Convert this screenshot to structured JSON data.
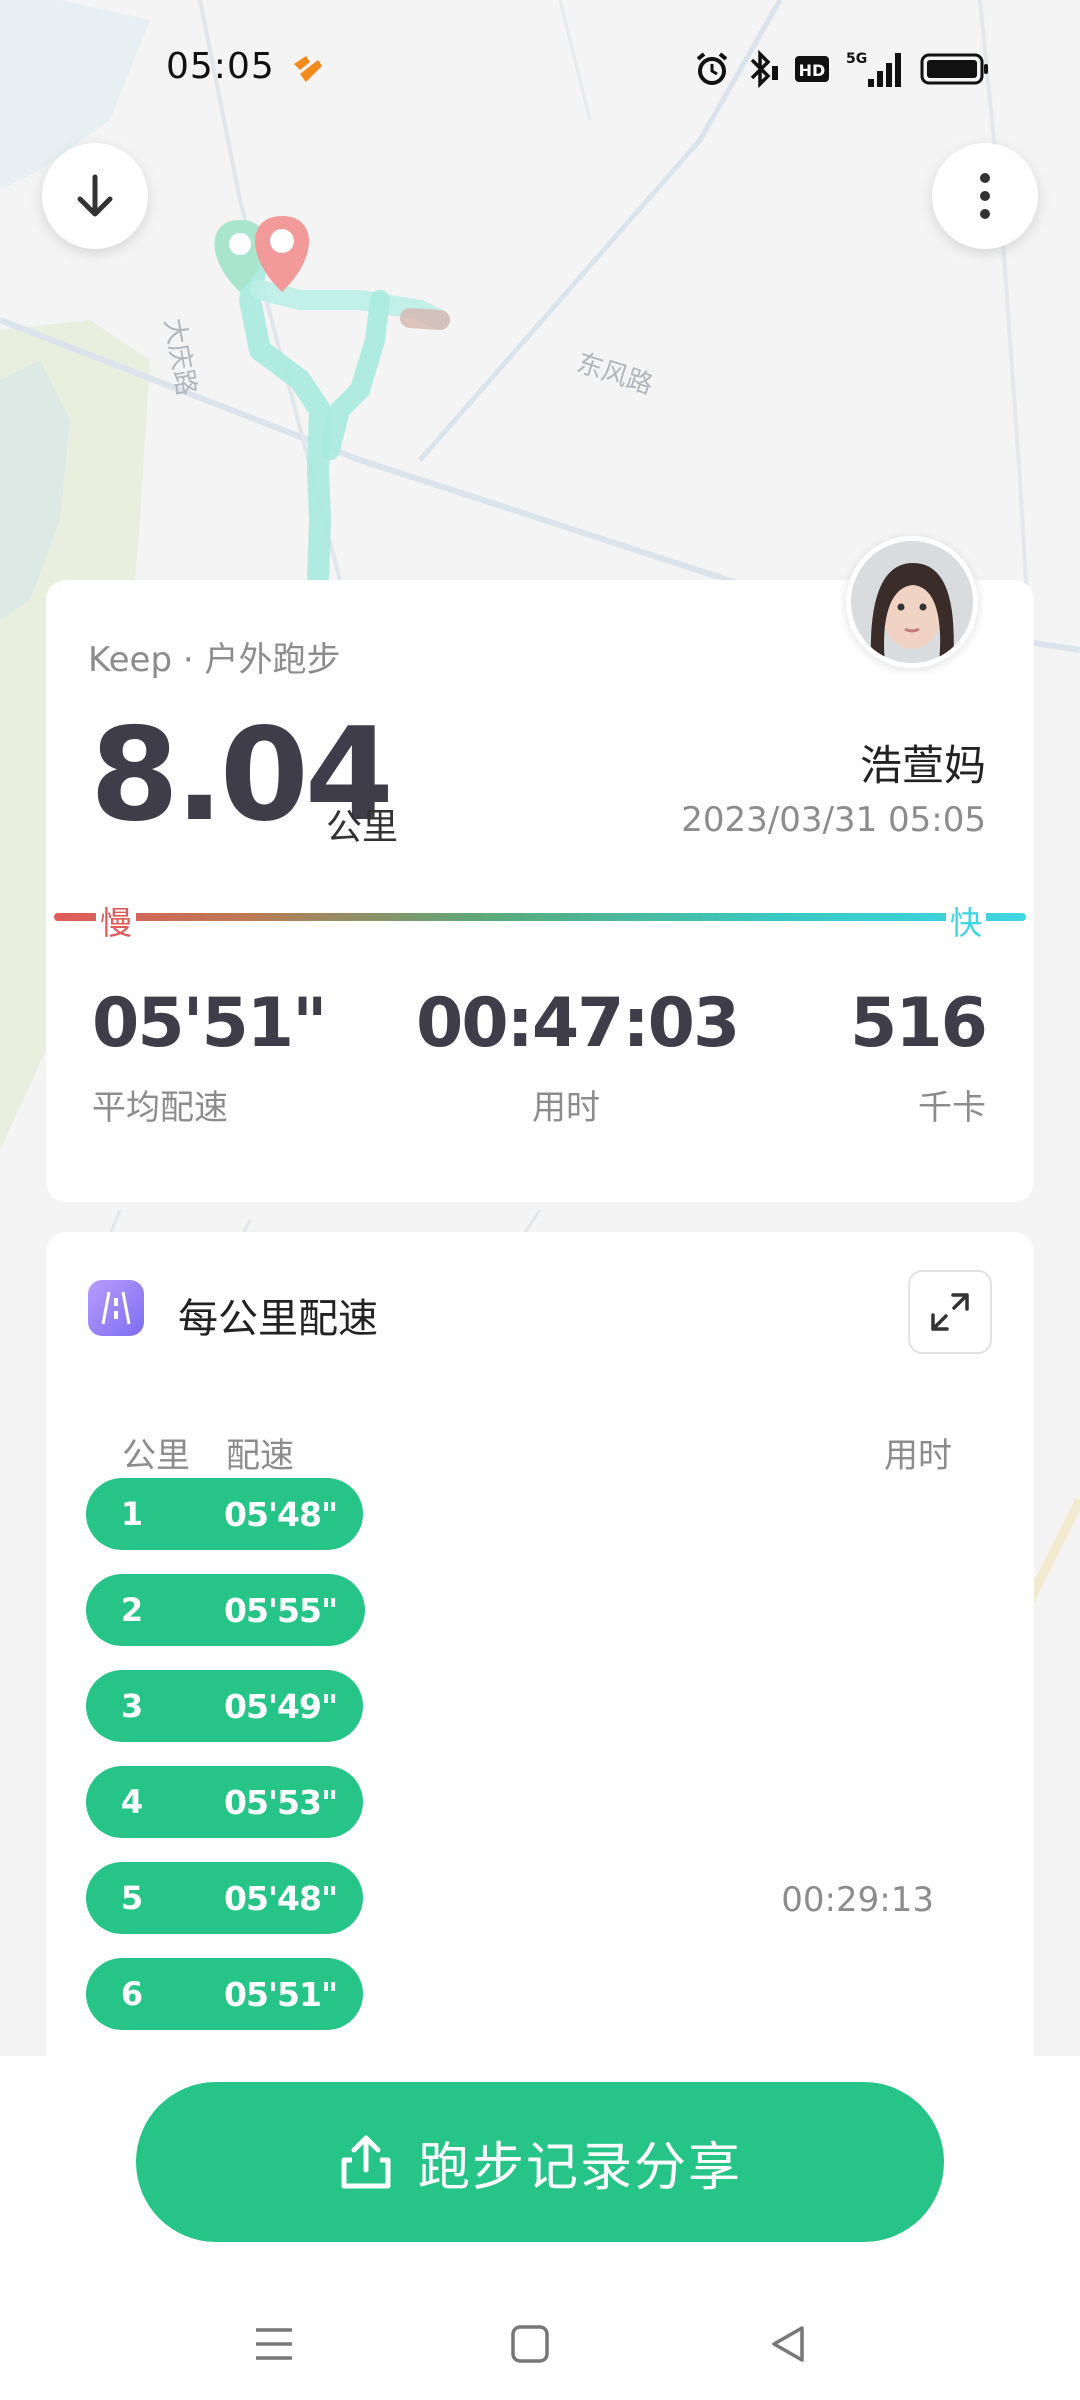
{
  "status_bar": {
    "time": "05:05",
    "icons": [
      "app-notification-icon",
      "alarm-icon",
      "bluetooth-icon",
      "hd-icon",
      "5g-signal-icon",
      "battery-icon"
    ],
    "hd_label": "HD",
    "network_label": "5G"
  },
  "map": {
    "road_labels": [
      "大庆路",
      "东风路"
    ],
    "route_colors": {
      "start": "#4fd0a8",
      "end": "#f07a7a",
      "track": "#7fe0d6"
    }
  },
  "map_buttons": {
    "download_icon": "arrow-down-icon",
    "more_icon": "vertical-dots-icon"
  },
  "summary": {
    "source": "Keep · 户外跑步",
    "distance": "8.04",
    "distance_unit": "公里",
    "user_name": "浩萱妈",
    "date": "2023/03/31 05:05",
    "speed_slow": "慢",
    "speed_fast": "快",
    "stats": [
      {
        "value": "05'51\"",
        "label": "平均配速"
      },
      {
        "value": "00:47:03",
        "label": "用时"
      },
      {
        "value": "516",
        "label": "千卡"
      }
    ]
  },
  "splits": {
    "title": "每公里配速",
    "columns": {
      "km": "公里",
      "pace": "配速",
      "time": "用时"
    },
    "rows": [
      {
        "km": "1",
        "pace": "05'48\"",
        "time": "",
        "relative_speed": 0.935
      },
      {
        "km": "2",
        "pace": "05'55\"",
        "time": "",
        "relative_speed": 0.942
      },
      {
        "km": "3",
        "pace": "05'49\"",
        "time": "",
        "relative_speed": 0.935
      },
      {
        "km": "4",
        "pace": "05'53\"",
        "time": "",
        "relative_speed": 0.935
      },
      {
        "km": "5",
        "pace": "05'48\"",
        "time": "00:29:13",
        "relative_speed": 0.935
      },
      {
        "km": "6",
        "pace": "05'51\"",
        "time": "",
        "relative_speed": 0.935
      }
    ],
    "accent": "#26c486"
  },
  "share_button": {
    "label": "跑步记录分享",
    "icon": "share-upload-icon",
    "color": "#26c486"
  },
  "nav_bar": {
    "buttons": [
      "menu-icon",
      "home-icon",
      "back-icon"
    ]
  }
}
